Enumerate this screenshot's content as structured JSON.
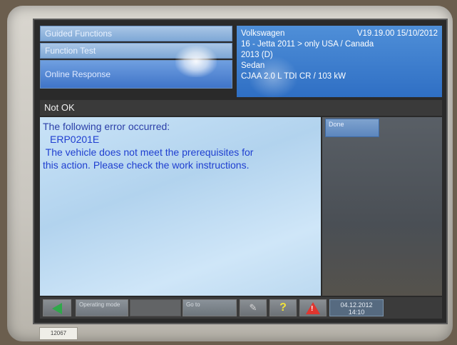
{
  "nav": {
    "items": [
      {
        "label": "Guided Functions"
      },
      {
        "label": "Function Test"
      },
      {
        "label": "Online Response"
      }
    ]
  },
  "vehicle": {
    "line1": "Volkswagen",
    "version": "V19.19.00 15/10/2012",
    "line2": "16 - Jetta 2011 > only USA / Canada",
    "line3": "2013 (D)",
    "line4": "Sedan",
    "line5": "CJAA 2.0 L TDI CR / 103 kW"
  },
  "status": {
    "text": "Not OK"
  },
  "message": {
    "lead": "The following error occurred:",
    "code": "ERP0201E",
    "line1": " The vehicle does not meet the prerequisites for",
    "line2": "this action. Please check the work instructions."
  },
  "side": {
    "done_label": "Done"
  },
  "bottom": {
    "btn1_label": "Operating mode",
    "btn2_label": "Go to",
    "help_glyph": "?",
    "tool_glyph": "✎",
    "warn_mark": "!",
    "date": "04.12.2012",
    "time": "14:10"
  },
  "device": {
    "tag": "12067"
  },
  "colors": {
    "message_text": "#1f3fd0",
    "header_blue": "#2f6fc4",
    "back_green": "#2fa84a",
    "warn_red": "#e0352e"
  }
}
